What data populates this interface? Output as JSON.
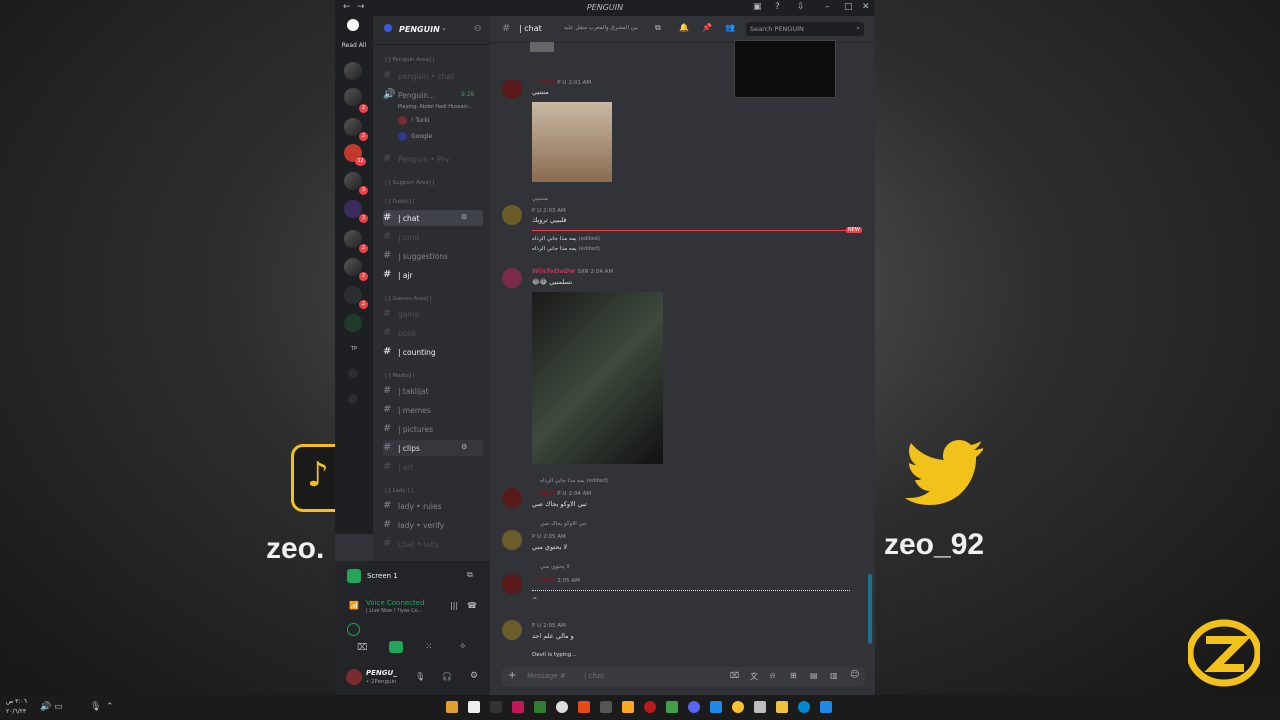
{
  "background": {
    "left_brand": "zeo.",
    "right_brand": "zeo_92"
  },
  "window": {
    "title": "PENGUIN"
  },
  "servers": {
    "read_all": "Read All",
    "mini_label": "TP",
    "badges": [
      "2",
      "2",
      "3",
      "3",
      "12",
      "3",
      "3",
      "2",
      "2",
      "2",
      "2"
    ]
  },
  "server_header": {
    "name": "PENGUIN"
  },
  "channels": {
    "cat_penguin_area": "| [ Penguin Area] |",
    "penguin_chat": "penguin • chat",
    "voice_penguin": "Penguin...",
    "voice_time": "9:28",
    "voice_playing": "Playing: Abdel Hadi Hussain...",
    "voice_user1": "! Turki",
    "voice_user2": "Google",
    "penguin_prv": "Penguin • Prv",
    "cat_support": "| [ Support Area] |",
    "cat_public": "| [ Public] |",
    "chat": "| chat",
    "cmd": "| cmd",
    "suggestions": "| suggestions",
    "ajr": "| ajr",
    "cat_games": "| [ Games Area] |",
    "game": "game",
    "bonk": "bonk",
    "counting": "| counting",
    "cat_media": "| [ Media] |",
    "taklijat": "| taklijat",
    "memes": "| memes",
    "pictures": "| pictures",
    "clips": "| clips",
    "art": "| art",
    "cat_lady": "| [ Lady ] |",
    "lady_rules": "lady • rules",
    "lady_verify": "lady • verify",
    "chat_lady": "chat • lady"
  },
  "bottom": {
    "screen_label": "Screen 1",
    "voice_connected": "Voice Connected",
    "voice_channel": "| Live Now / ?iyas Co...",
    "user_name": "PENGU_",
    "user_status": "• 2Penguin"
  },
  "chat": {
    "channel_name": "| chat",
    "topic": "بين المشرق والمغرب منقل عليه",
    "search_placeholder": "Search PENGUIN",
    "new_badge": "NEW",
    "typing": "Devil is typing...",
    "composer_placeholder": "Message #",
    "composer_channel": "| chat",
    "messages": [
      {
        "user": "! Turki",
        "tag": "P U",
        "time": "2:01 AM",
        "text": "منننيي"
      },
      {
        "user": "",
        "tag": "P U",
        "time": "2:03 AM",
        "text": "قلبييي ترويك",
        "reply": "مننننيي"
      },
      {
        "text": "يمه مذا جاني الرذاه",
        "edited": "(edited)"
      },
      {
        "text": "يمه مذا جاني الرذاه",
        "edited": "(edited)"
      },
      {
        "user": "WinToDaDw",
        "tag": "SXR",
        "time": "2:04 AM",
        "text": "😂😂 تسلمنيي"
      },
      {
        "reply": "يمه مذا جاني الرذاه",
        "edited": "(edited)"
      },
      {
        "user": "! Turki",
        "tag": "P U",
        "time": "2:04 AM",
        "text": "تبي الاوكو يجاك صي"
      },
      {
        "reply": "تبي الاوكو يجاك صي",
        "tag": "P U",
        "time": "2:05 AM",
        "text": "لا يحتوي مني"
      },
      {
        "reply": "لا يحتوي مني",
        "user": "! Turki",
        "time": "2:05 AM",
        "text": "^"
      },
      {
        "tag": "P U",
        "time": "2:05 AM",
        "text": "و مالي علم احد"
      }
    ]
  },
  "taskbar": {
    "time": "٣:٠٦ ص",
    "date": "٢٠/٦/٢٣"
  }
}
